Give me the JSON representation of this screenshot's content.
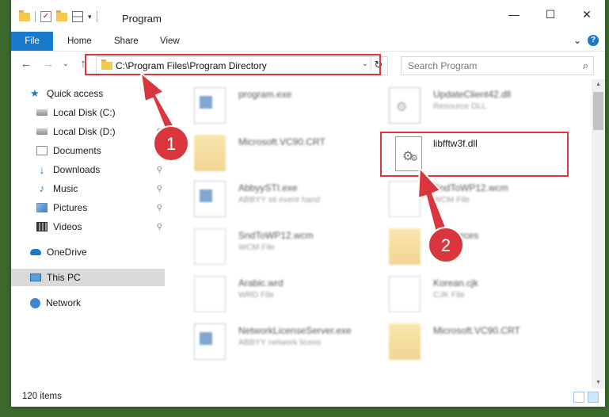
{
  "window": {
    "title": "Program",
    "controls": {
      "minimize": "—",
      "maximize": "☐",
      "close": "✕"
    }
  },
  "ribbon": {
    "tabs": [
      {
        "label": "File"
      },
      {
        "label": "Home"
      },
      {
        "label": "Share"
      },
      {
        "label": "View"
      }
    ],
    "collapse_glyph": "⌄",
    "help_glyph": "?"
  },
  "nav": {
    "back": "←",
    "forward": "→",
    "recent": "⌄",
    "up": "↑"
  },
  "address": {
    "path": "C:\\Program Files\\Program Directory",
    "dropdown_glyph": "⌄",
    "refresh_glyph": "↻"
  },
  "search": {
    "placeholder": "Search Program",
    "icon_glyph": "⌕"
  },
  "sidebar": {
    "items": [
      {
        "label": "Quick access",
        "icon": "star-icon",
        "pinned": false
      },
      {
        "label": "Local Disk (C:)",
        "icon": "disk-icon",
        "pinned": true
      },
      {
        "label": "Local Disk (D:)",
        "icon": "disk-icon",
        "pinned": true
      },
      {
        "label": "Documents",
        "icon": "documents-icon",
        "pinned": true
      },
      {
        "label": "Downloads",
        "icon": "downloads-icon",
        "pinned": true
      },
      {
        "label": "Music",
        "icon": "music-icon",
        "pinned": true
      },
      {
        "label": "Pictures",
        "icon": "pictures-icon",
        "pinned": true
      },
      {
        "label": "Videos",
        "icon": "videos-icon",
        "pinned": true
      },
      {
        "label": "OneDrive",
        "icon": "onedrive-icon",
        "pinned": false
      },
      {
        "label": "This PC",
        "icon": "this-pc-icon",
        "pinned": false
      },
      {
        "label": "Network",
        "icon": "network-icon",
        "pinned": false
      }
    ],
    "pin_glyph": "📌"
  },
  "files": [
    {
      "name": "program.exe",
      "sub": "",
      "kind": "exe",
      "blurred": true
    },
    {
      "name": "UpdateClient42.dll",
      "sub": "Resource DLL",
      "kind": "dll",
      "blurred": true
    },
    {
      "name": "Microsoft.VC90.CRT",
      "sub": "",
      "kind": "folder",
      "blurred": true
    },
    {
      "name": "libfftw3f.dll",
      "sub": "",
      "kind": "dll",
      "blurred": false
    },
    {
      "name": "AbbyySTI.exe",
      "sub": "ABBYY sti event hand",
      "kind": "exe",
      "blurred": true
    },
    {
      "name": "SndToWP12.wcm",
      "sub": "WCM File",
      "kind": "page",
      "blurred": true
    },
    {
      "name": "SndToWP12.wcm",
      "sub": "WCM File",
      "kind": "page",
      "blurred": true
    },
    {
      "name": "Resources",
      "sub": "",
      "kind": "folder",
      "blurred": true
    },
    {
      "name": "Arabic.wrd",
      "sub": "WRD File",
      "kind": "page",
      "blurred": true
    },
    {
      "name": "Korean.cjk",
      "sub": "CJK File",
      "kind": "page",
      "blurred": true
    },
    {
      "name": "NetworkLicenseServer.exe",
      "sub": "ABBYY network licens",
      "kind": "exe",
      "blurred": true
    },
    {
      "name": "Microsoft.VC90.CRT",
      "sub": "",
      "kind": "folder",
      "blurred": true
    }
  ],
  "status": {
    "item_count": "120 items"
  },
  "annotations": {
    "step1": "1",
    "step2": "2",
    "color": "#d9363e"
  },
  "colors": {
    "accent": "#1979ca",
    "highlight": "#d9363e",
    "selected_nav": "#d9d9d9"
  }
}
